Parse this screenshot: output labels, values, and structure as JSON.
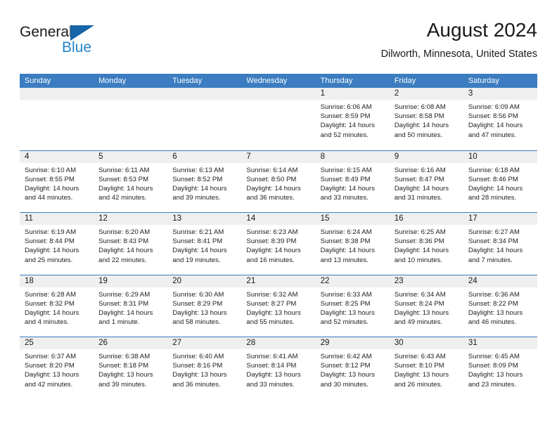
{
  "brand": {
    "name_top": "General",
    "name_bottom": "Blue",
    "accent_color": "#1565a8",
    "text_color": "#2283c8"
  },
  "header": {
    "title": "August 2024",
    "subtitle": "Dilworth, Minnesota, United States"
  },
  "calendar": {
    "header_bg": "#3b7dc0",
    "day_band_bg": "#efefef",
    "weekdays": [
      "Sunday",
      "Monday",
      "Tuesday",
      "Wednesday",
      "Thursday",
      "Friday",
      "Saturday"
    ],
    "weeks": [
      [
        {
          "day": "",
          "empty": true
        },
        {
          "day": "",
          "empty": true
        },
        {
          "day": "",
          "empty": true
        },
        {
          "day": "",
          "empty": true
        },
        {
          "day": "1",
          "sunrise": "Sunrise: 6:06 AM",
          "sunset": "Sunset: 8:59 PM",
          "daylight_1": "Daylight: 14 hours",
          "daylight_2": "and 52 minutes."
        },
        {
          "day": "2",
          "sunrise": "Sunrise: 6:08 AM",
          "sunset": "Sunset: 8:58 PM",
          "daylight_1": "Daylight: 14 hours",
          "daylight_2": "and 50 minutes."
        },
        {
          "day": "3",
          "sunrise": "Sunrise: 6:09 AM",
          "sunset": "Sunset: 8:56 PM",
          "daylight_1": "Daylight: 14 hours",
          "daylight_2": "and 47 minutes."
        }
      ],
      [
        {
          "day": "4",
          "sunrise": "Sunrise: 6:10 AM",
          "sunset": "Sunset: 8:55 PM",
          "daylight_1": "Daylight: 14 hours",
          "daylight_2": "and 44 minutes."
        },
        {
          "day": "5",
          "sunrise": "Sunrise: 6:11 AM",
          "sunset": "Sunset: 8:53 PM",
          "daylight_1": "Daylight: 14 hours",
          "daylight_2": "and 42 minutes."
        },
        {
          "day": "6",
          "sunrise": "Sunrise: 6:13 AM",
          "sunset": "Sunset: 8:52 PM",
          "daylight_1": "Daylight: 14 hours",
          "daylight_2": "and 39 minutes."
        },
        {
          "day": "7",
          "sunrise": "Sunrise: 6:14 AM",
          "sunset": "Sunset: 8:50 PM",
          "daylight_1": "Daylight: 14 hours",
          "daylight_2": "and 36 minutes."
        },
        {
          "day": "8",
          "sunrise": "Sunrise: 6:15 AM",
          "sunset": "Sunset: 8:49 PM",
          "daylight_1": "Daylight: 14 hours",
          "daylight_2": "and 33 minutes."
        },
        {
          "day": "9",
          "sunrise": "Sunrise: 6:16 AM",
          "sunset": "Sunset: 8:47 PM",
          "daylight_1": "Daylight: 14 hours",
          "daylight_2": "and 31 minutes."
        },
        {
          "day": "10",
          "sunrise": "Sunrise: 6:18 AM",
          "sunset": "Sunset: 8:46 PM",
          "daylight_1": "Daylight: 14 hours",
          "daylight_2": "and 28 minutes."
        }
      ],
      [
        {
          "day": "11",
          "sunrise": "Sunrise: 6:19 AM",
          "sunset": "Sunset: 8:44 PM",
          "daylight_1": "Daylight: 14 hours",
          "daylight_2": "and 25 minutes."
        },
        {
          "day": "12",
          "sunrise": "Sunrise: 6:20 AM",
          "sunset": "Sunset: 8:43 PM",
          "daylight_1": "Daylight: 14 hours",
          "daylight_2": "and 22 minutes."
        },
        {
          "day": "13",
          "sunrise": "Sunrise: 6:21 AM",
          "sunset": "Sunset: 8:41 PM",
          "daylight_1": "Daylight: 14 hours",
          "daylight_2": "and 19 minutes."
        },
        {
          "day": "14",
          "sunrise": "Sunrise: 6:23 AM",
          "sunset": "Sunset: 8:39 PM",
          "daylight_1": "Daylight: 14 hours",
          "daylight_2": "and 16 minutes."
        },
        {
          "day": "15",
          "sunrise": "Sunrise: 6:24 AM",
          "sunset": "Sunset: 8:38 PM",
          "daylight_1": "Daylight: 14 hours",
          "daylight_2": "and 13 minutes."
        },
        {
          "day": "16",
          "sunrise": "Sunrise: 6:25 AM",
          "sunset": "Sunset: 8:36 PM",
          "daylight_1": "Daylight: 14 hours",
          "daylight_2": "and 10 minutes."
        },
        {
          "day": "17",
          "sunrise": "Sunrise: 6:27 AM",
          "sunset": "Sunset: 8:34 PM",
          "daylight_1": "Daylight: 14 hours",
          "daylight_2": "and 7 minutes."
        }
      ],
      [
        {
          "day": "18",
          "sunrise": "Sunrise: 6:28 AM",
          "sunset": "Sunset: 8:32 PM",
          "daylight_1": "Daylight: 14 hours",
          "daylight_2": "and 4 minutes."
        },
        {
          "day": "19",
          "sunrise": "Sunrise: 6:29 AM",
          "sunset": "Sunset: 8:31 PM",
          "daylight_1": "Daylight: 14 hours",
          "daylight_2": "and 1 minute."
        },
        {
          "day": "20",
          "sunrise": "Sunrise: 6:30 AM",
          "sunset": "Sunset: 8:29 PM",
          "daylight_1": "Daylight: 13 hours",
          "daylight_2": "and 58 minutes."
        },
        {
          "day": "21",
          "sunrise": "Sunrise: 6:32 AM",
          "sunset": "Sunset: 8:27 PM",
          "daylight_1": "Daylight: 13 hours",
          "daylight_2": "and 55 minutes."
        },
        {
          "day": "22",
          "sunrise": "Sunrise: 6:33 AM",
          "sunset": "Sunset: 8:25 PM",
          "daylight_1": "Daylight: 13 hours",
          "daylight_2": "and 52 minutes."
        },
        {
          "day": "23",
          "sunrise": "Sunrise: 6:34 AM",
          "sunset": "Sunset: 8:24 PM",
          "daylight_1": "Daylight: 13 hours",
          "daylight_2": "and 49 minutes."
        },
        {
          "day": "24",
          "sunrise": "Sunrise: 6:36 AM",
          "sunset": "Sunset: 8:22 PM",
          "daylight_1": "Daylight: 13 hours",
          "daylight_2": "and 46 minutes."
        }
      ],
      [
        {
          "day": "25",
          "sunrise": "Sunrise: 6:37 AM",
          "sunset": "Sunset: 8:20 PM",
          "daylight_1": "Daylight: 13 hours",
          "daylight_2": "and 42 minutes."
        },
        {
          "day": "26",
          "sunrise": "Sunrise: 6:38 AM",
          "sunset": "Sunset: 8:18 PM",
          "daylight_1": "Daylight: 13 hours",
          "daylight_2": "and 39 minutes."
        },
        {
          "day": "27",
          "sunrise": "Sunrise: 6:40 AM",
          "sunset": "Sunset: 8:16 PM",
          "daylight_1": "Daylight: 13 hours",
          "daylight_2": "and 36 minutes."
        },
        {
          "day": "28",
          "sunrise": "Sunrise: 6:41 AM",
          "sunset": "Sunset: 8:14 PM",
          "daylight_1": "Daylight: 13 hours",
          "daylight_2": "and 33 minutes."
        },
        {
          "day": "29",
          "sunrise": "Sunrise: 6:42 AM",
          "sunset": "Sunset: 8:12 PM",
          "daylight_1": "Daylight: 13 hours",
          "daylight_2": "and 30 minutes."
        },
        {
          "day": "30",
          "sunrise": "Sunrise: 6:43 AM",
          "sunset": "Sunset: 8:10 PM",
          "daylight_1": "Daylight: 13 hours",
          "daylight_2": "and 26 minutes."
        },
        {
          "day": "31",
          "sunrise": "Sunrise: 6:45 AM",
          "sunset": "Sunset: 8:09 PM",
          "daylight_1": "Daylight: 13 hours",
          "daylight_2": "and 23 minutes."
        }
      ]
    ]
  }
}
